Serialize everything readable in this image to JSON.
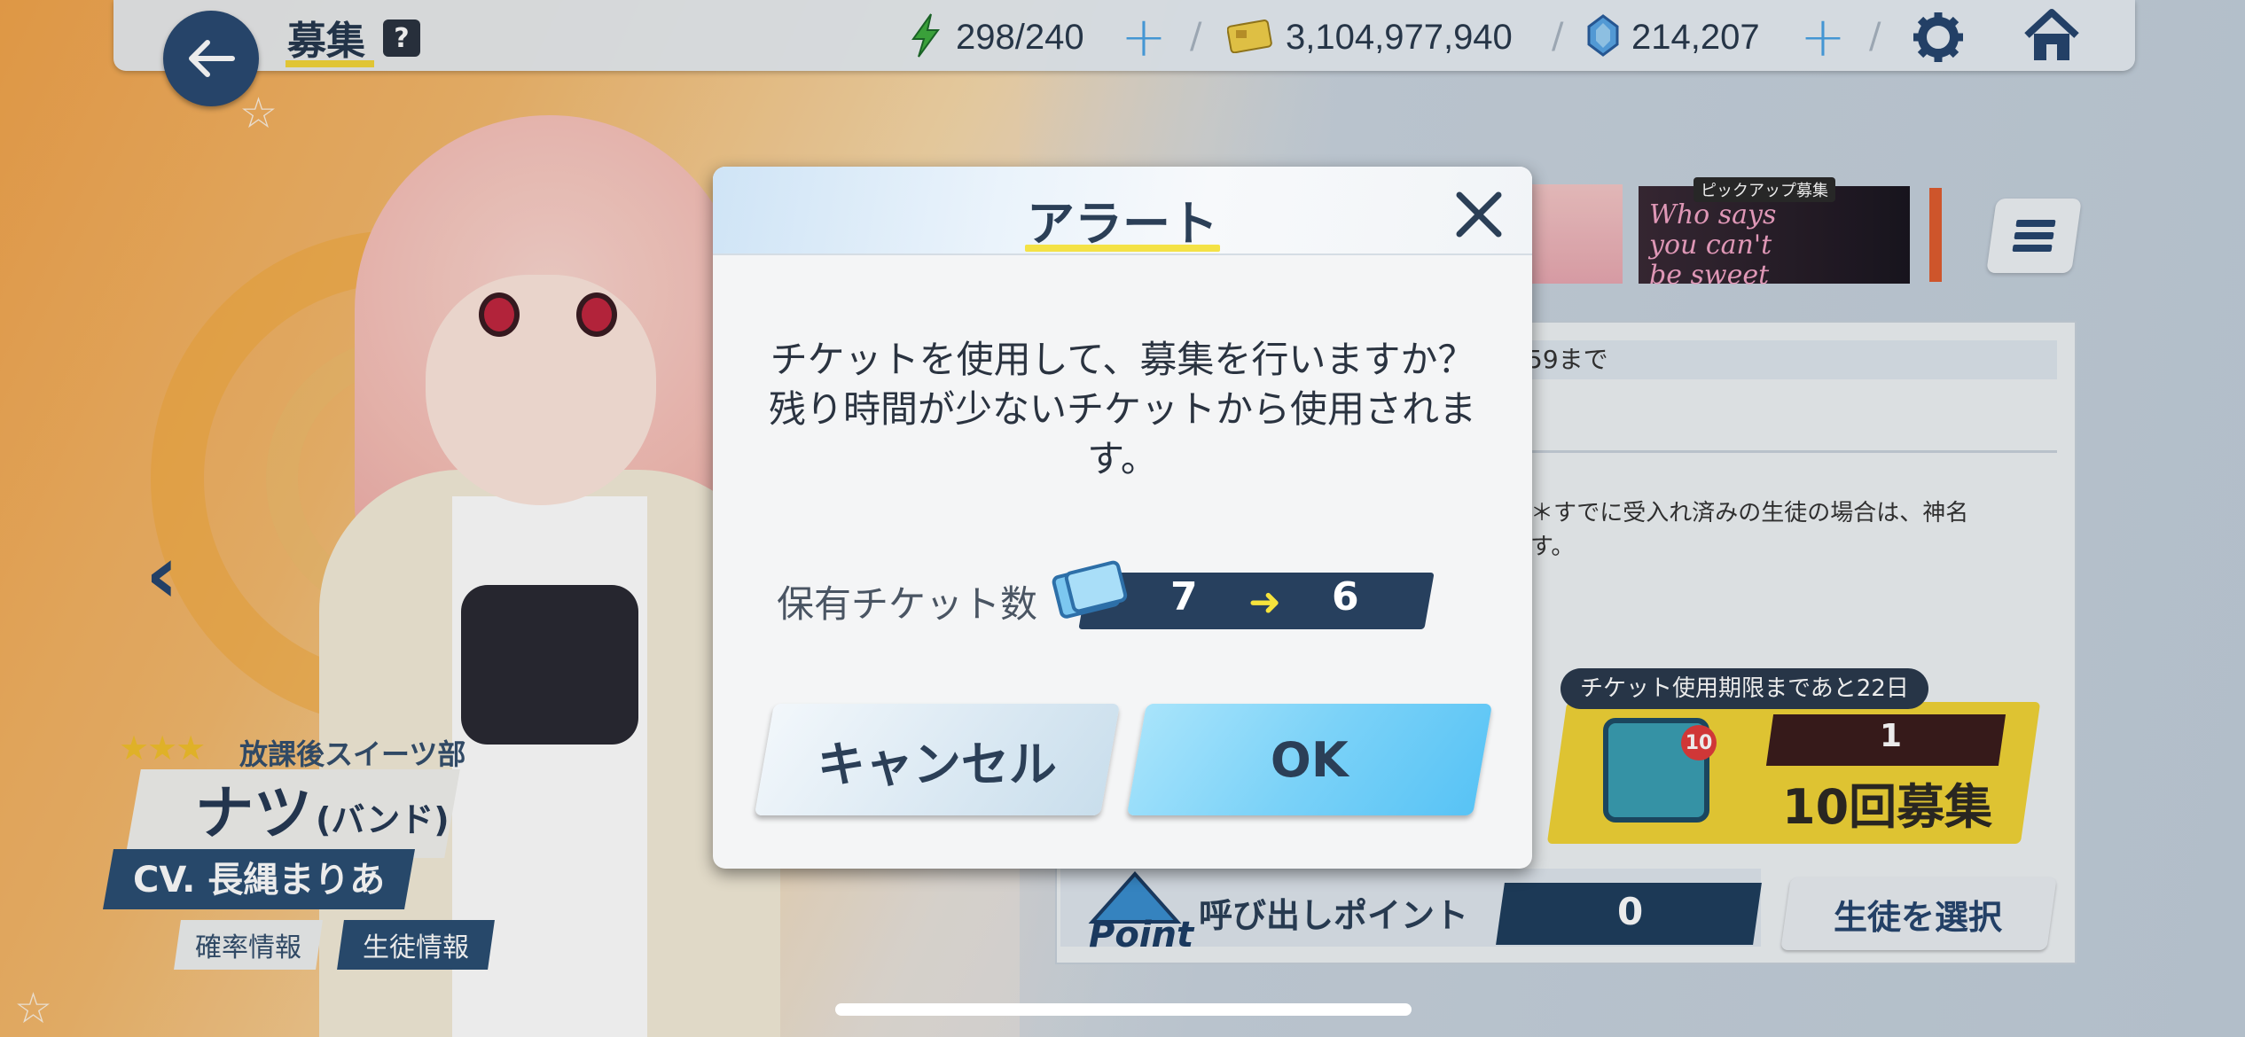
{
  "header": {
    "title": "募集",
    "help_icon": "?",
    "ap": "298/240",
    "credits": "3,104,977,940",
    "pyroxene": "214,207",
    "separator": "/"
  },
  "character": {
    "club": "放課後スイーツ部",
    "name": "ナツ",
    "variant": "(バンド)",
    "cv": "CV. 長縄まりあ",
    "rate_button": "確率情報",
    "student_info_button": "生徒情報",
    "stars": "★★★"
  },
  "banner": {
    "pickup_tag": "ピックアップ募集",
    "pickup_title": "Who says you can't be sweet"
  },
  "info": {
    "date_fragment": "59まで",
    "note_fragment": "！＊すでに受入れ済みの生徒の場合は、神名\nます。"
  },
  "recruit": {
    "expiry_tooltip": "チケット使用期限まであと22日",
    "envelope_badge": "10",
    "ticket_count": "1",
    "ten_pull_label": "10回募集",
    "point_word": "Point",
    "point_label": "呼び出しポイント",
    "point_value": "0",
    "select_student": "生徒を選択"
  },
  "modal": {
    "title": "アラート",
    "message": "チケットを使用して、募集を行いますか？\n残り時間が少ないチケットから使用されま\nす。",
    "ticket_label": "保有チケット数",
    "ticket_from": "7",
    "ticket_arrow": "➜",
    "ticket_to": "6",
    "cancel_label": "キャンセル",
    "ok_label": "OK"
  },
  "colors": {
    "accent_blue": "#58c3f5",
    "navy": "#27405e",
    "highlight_yellow": "#f4e246"
  },
  "icons": [
    "back-arrow-icon",
    "help-icon",
    "energy-bolt-icon",
    "credit-card-icon",
    "pyroxene-gem-icon",
    "gear-icon",
    "home-icon",
    "menu-icon",
    "close-icon",
    "ticket-icon",
    "envelope-icon",
    "chevron-left-icon",
    "chevron-right-icon"
  ]
}
